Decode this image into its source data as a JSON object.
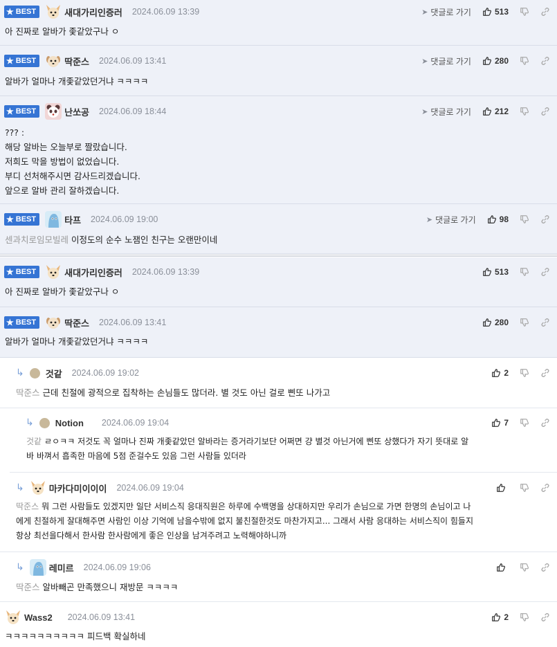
{
  "labels": {
    "best": "BEST",
    "reply_to": "댓글로 가기"
  },
  "best_comments": [
    {
      "nick": "새대가리인증러",
      "date": "2024.06.09 13:39",
      "likes": "513",
      "lines": [
        "아 진짜로 알바가 좇같았구나 ㅇ"
      ],
      "avatar": "dog-face"
    },
    {
      "nick": "딱준스",
      "date": "2024.06.09 13:41",
      "likes": "280",
      "lines": [
        "알바가 얼마나 개좇같았던거냐 ㅋㅋㅋㅋ"
      ],
      "avatar": "puppy-face"
    },
    {
      "nick": "난쏘공",
      "date": "2024.06.09 18:44",
      "likes": "212",
      "lines": [
        "??? :",
        "해당 알바는 오늘부로 짤랐습니다.",
        "저희도 막을 방법이 없었습니다.",
        "부디 선처해주시면 감사드리겠습니다.",
        "앞으로 알바 관리 잘하겠습니다."
      ],
      "avatar": "panda-face"
    },
    {
      "nick": "타프",
      "date": "2024.06.09 19:00",
      "likes": "98",
      "ref": "센과치로임모빌레",
      "lines": [
        "이정도의 순수 노잼인 친구는 오랜만이네"
      ],
      "avatar": "blue-creature"
    }
  ],
  "comments": [
    {
      "nick": "새대가리인증러",
      "date": "2024.06.09 13:39",
      "likes": "513",
      "best": true,
      "lines": [
        "아 진짜로 알바가 좇같았구나 ㅇ"
      ],
      "avatar": "dog-face"
    },
    {
      "nick": "딱준스",
      "date": "2024.06.09 13:41",
      "likes": "280",
      "best": true,
      "lines": [
        "알바가 얼마나 개좇같았던거냐 ㅋㅋㅋㅋ"
      ],
      "avatar": "puppy-face"
    },
    {
      "nick": "것같",
      "date": "2024.06.09 19:02",
      "likes": "2",
      "ref": "딱준스",
      "lines": [
        "근데 친절에 광적으로 집착하는 손님들도 많더라. 별 것도 아닌 걸로 삔또 나가고"
      ],
      "avatar": "dot"
    },
    {
      "nick": "Notion",
      "date": "2024.06.09 19:04",
      "likes": "7",
      "ref": "것같",
      "lines": [
        "ㄹㅇㅋㅋ 저것도 꼭 얼마나 진짜 개좇같았던 알바라는 증거라기보단 어쩌면 걍 별것 아닌거에 삔또 상했다가 자기 뜻대로 알",
        "바 바껴서 흡족한 마음에 5점 준걸수도 있음 그런 사람들 있더라"
      ],
      "avatar": "dot"
    },
    {
      "nick": "마카다미이이이",
      "date": "2024.06.09 19:04",
      "likes": "",
      "ref": "딱준스",
      "lines": [
        "뭐 그런 사람들도 있겠지만 일단 서비스직 응대직원은 하루에 수백명을 상대하지만 우리가 손님으로 가면 한명의 손님이고 나",
        "에게 친절하게 잘대해주면 사람인 이상 기억에 남을수밖에 없지 불친절한것도 마찬가지고... 그래서 사람 응대하는 서비스직이 힘들지",
        "항상 최선을다해서 한사람 한사람에게 좋은 인상을 남겨주려고 노력해야하니까"
      ],
      "avatar": "dog-face"
    },
    {
      "nick": "레미르",
      "date": "2024.06.09 19:06",
      "likes": "",
      "ref": "딱준스",
      "lines": [
        "알바빼곤 만족했으니 재방문 ㅋㅋㅋㅋ"
      ],
      "avatar": "blue-creature"
    },
    {
      "nick": "Wass2",
      "date": "2024.06.09 13:41",
      "likes": "2",
      "lines": [
        "ㅋㅋㅋㅋㅋㅋㅋㅋㅋㅋ 피드백 확실하네"
      ],
      "avatar": "dog-face"
    }
  ],
  "colors": {
    "best_bg": "#eef1f8",
    "badge": "#3574d4",
    "ref_text": "#999999"
  }
}
